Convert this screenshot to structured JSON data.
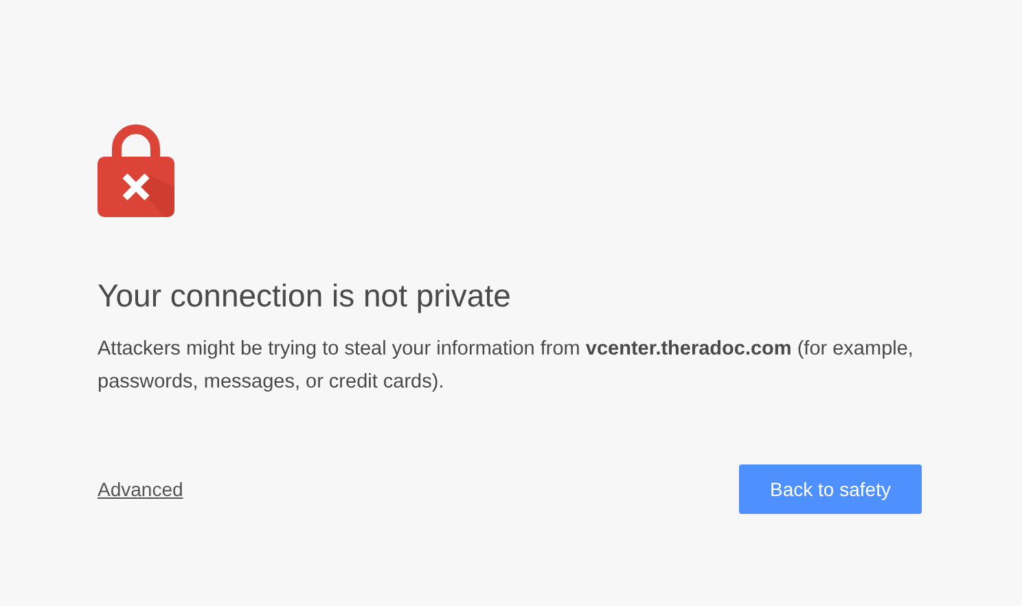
{
  "heading": "Your connection is not private",
  "message": "Attackers might be trying to steal your information from **vcenter.theradoc.com** (for example, passwords, messages, or credit cards).",
  "advanced_link": "Advanced",
  "primary_button": "Back to safety"
}
